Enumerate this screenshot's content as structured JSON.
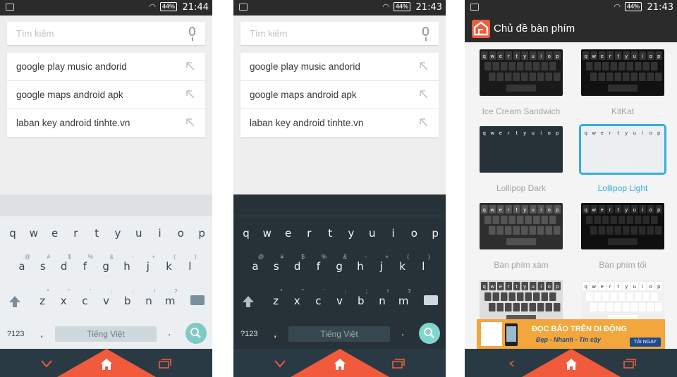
{
  "status": {
    "battery": "44%",
    "time_p1": "21:44",
    "time_p2": "21:43",
    "time_p3": "21:43"
  },
  "search": {
    "placeholder": "Tìm kiếm"
  },
  "suggestions": [
    "google play music andorid",
    "google maps android apk",
    "laban key android tinhte.vn"
  ],
  "keyboard": {
    "row1": [
      "q",
      "w",
      "e",
      "r",
      "t",
      "y",
      "u",
      "i",
      "o",
      "p"
    ],
    "row2": [
      "a",
      "s",
      "d",
      "f",
      "g",
      "h",
      "j",
      "k",
      "l"
    ],
    "row2_hints": [
      "@",
      "#",
      "$",
      "%",
      "&",
      "-",
      "+",
      "(",
      ")"
    ],
    "row3": [
      "z",
      "x",
      "c",
      "v",
      "b",
      "n",
      "m"
    ],
    "row3_hints": [
      "*",
      "\"",
      "'",
      ":",
      ";",
      "!",
      "?"
    ],
    "symbols": "?123",
    "comma": ",",
    "space_label": "Tiếng Việt",
    "period": "."
  },
  "themes_screen": {
    "title": "Chủ đề bàn phím",
    "themes": [
      {
        "label": "Ice Cream Sandwich",
        "bg": "#1a1a1a",
        "key": "#3a3a3a",
        "text": "#ffffff",
        "selected": false
      },
      {
        "label": "KitKat",
        "bg": "#111111",
        "key": "#333333",
        "text": "#ffffff",
        "selected": false
      },
      {
        "label": "Lollipop Dark",
        "bg": "#263238",
        "key": "#263238",
        "text": "#ffffff",
        "selected": false
      },
      {
        "label": "Lollipop Light",
        "bg": "#eceff1",
        "key": "#eceff1",
        "text": "#37474f",
        "selected": true
      },
      {
        "label": "Bàn phím xám",
        "bg": "#2e2e2e",
        "key": "#555555",
        "text": "#ffffff",
        "selected": false
      },
      {
        "label": "Bàn phím tối",
        "bg": "#0f0f0f",
        "key": "#2a2a2a",
        "text": "#ffffff",
        "selected": false
      },
      {
        "label": "",
        "bg": "#dddddd",
        "key": "#4a4a4a",
        "text": "#ffffff",
        "selected": false
      },
      {
        "label": "",
        "bg": "#f0f0f0",
        "key": "#ffffff",
        "text": "#333333",
        "selected": false
      }
    ]
  },
  "ad": {
    "line1": "ĐỌC BÁO TRÊN DI ĐỘNG",
    "line2": "Đẹp - Nhanh - Tin cậy",
    "button": "TẢI NGAY"
  },
  "colors": {
    "accent": "#f15a3b",
    "nav": "#2a3a44",
    "selected": "#33aee0"
  }
}
